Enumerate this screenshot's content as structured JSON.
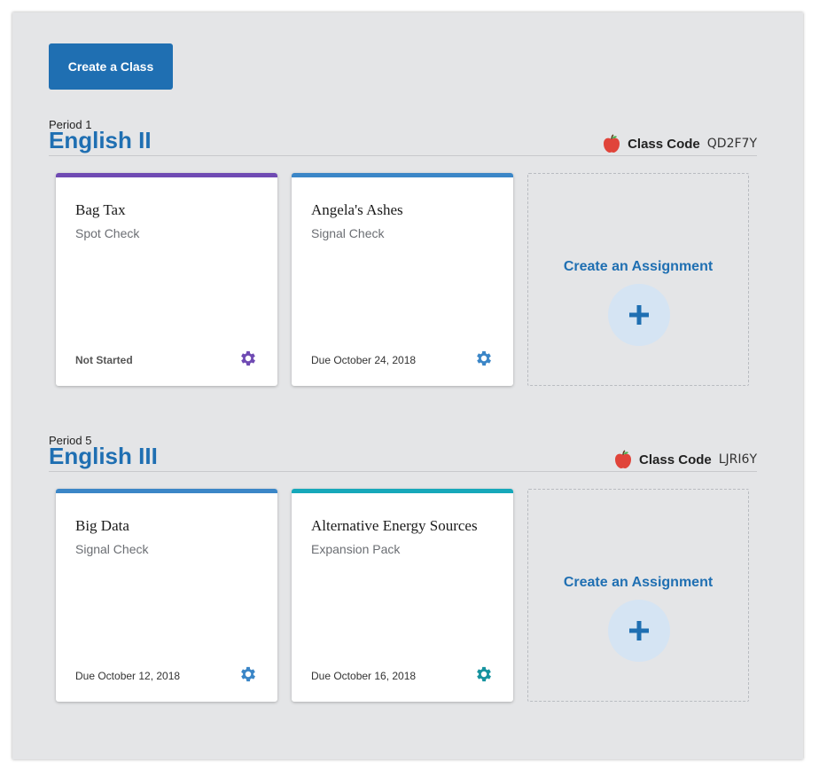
{
  "toolbar": {
    "create_class_label": "Create a Class"
  },
  "colors": {
    "primary": "#1f6fb2",
    "purple": "#6f4ab3",
    "blue": "#3b86c7",
    "teal": "#16a8ba",
    "teal_gear": "#16939f",
    "apple": "#e0443a"
  },
  "classes": [
    {
      "period": "Period 1",
      "name": "English II",
      "code_label": "Class Code",
      "code": "QD2F7Y",
      "assignments": [
        {
          "title": "Bag Tax",
          "type": "Spot Check",
          "status": "Not Started",
          "accent": "#6f4ab3",
          "icon": "gear-icon"
        },
        {
          "title": "Angela's Ashes",
          "type": "Signal Check",
          "status": "Due October 24, 2018",
          "accent": "#3b86c7",
          "icon": "gear-icon"
        }
      ],
      "create_label": "Create an Assignment"
    },
    {
      "period": "Period 5",
      "name": "English III",
      "code_label": "Class Code",
      "code": "LJRI6Y",
      "assignments": [
        {
          "title": "Big Data",
          "type": "Signal Check",
          "status": "Due October 12, 2018",
          "accent": "#3b86c7",
          "icon": "gear-icon"
        },
        {
          "title": "Alternative Energy Sources",
          "type": "Expansion Pack",
          "status": "Due October 16, 2018",
          "accent": "#16a8ba",
          "icon": "gear-icon"
        }
      ],
      "create_label": "Create an Assignment"
    }
  ]
}
